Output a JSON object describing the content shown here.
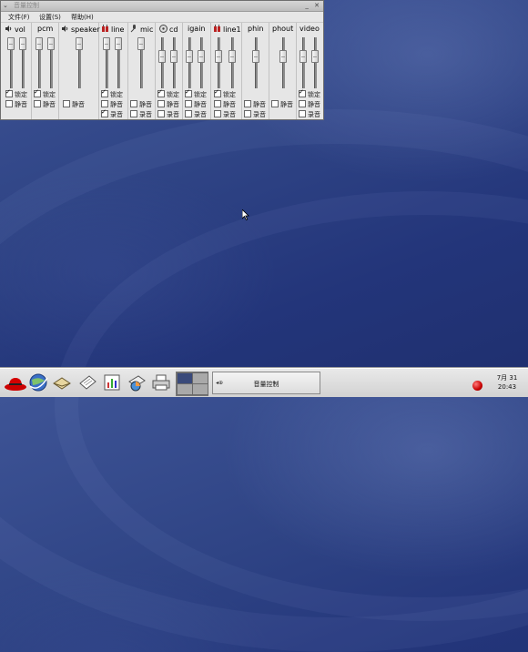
{
  "window": {
    "title": "音量控制",
    "menu": [
      "文件(F)",
      "设置(S)",
      "帮助(H)"
    ],
    "title_buttons": "_ ✕"
  },
  "channels": [
    {
      "name": "vol",
      "icon": "speaker-icon",
      "lock_label": "锁定",
      "lock": true,
      "mute_label": "静音"
    },
    {
      "name": "pcm",
      "icon": "",
      "lock_label": "锁定",
      "lock": true,
      "mute_label": "静音"
    },
    {
      "name": "speaker",
      "icon": "speaker-icon",
      "mute_label": "静音"
    },
    {
      "name": "line",
      "icon": "line-in-icon",
      "lock_label": "锁定",
      "lock": true,
      "mute_label": "静音",
      "rec_label": "录音",
      "rec": true
    },
    {
      "name": "mic",
      "icon": "microphone-icon",
      "mute_label": "静音",
      "rec_label": "录音"
    },
    {
      "name": "cd",
      "icon": "cd-icon",
      "lock_label": "锁定",
      "lock": true,
      "mute_label": "静音",
      "rec_label": "录音"
    },
    {
      "name": "igain",
      "icon": "",
      "lock_label": "锁定",
      "lock": true,
      "mute_label": "静音",
      "rec_label": "录音"
    },
    {
      "name": "line1",
      "icon": "line-in-icon",
      "lock_label": "锁定",
      "lock": true,
      "mute_label": "静音",
      "rec_label": "录音"
    },
    {
      "name": "phin",
      "icon": "",
      "mute_label": "静音",
      "rec_label": "录音"
    },
    {
      "name": "phout",
      "icon": "",
      "mute_label": "静音"
    },
    {
      "name": "video",
      "icon": "",
      "lock_label": "锁定",
      "lock": true,
      "mute_label": "静音",
      "rec_label": "录音"
    }
  ],
  "taskbar": {
    "launchers": [
      "redhat-menu-icon",
      "web-browser-icon",
      "email-icon",
      "text-editor-icon",
      "spreadsheet-icon",
      "presentation-icon",
      "printer-icon"
    ],
    "task_button": {
      "icon_text": "◂⊕",
      "label": "音量控制"
    },
    "clock_date": "7月 31",
    "clock_time": "20:43"
  }
}
